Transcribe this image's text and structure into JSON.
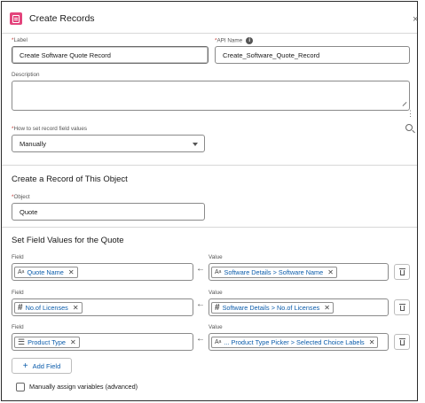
{
  "header": {
    "title": "Create Records",
    "close_icon": "close-icon"
  },
  "label_field": {
    "label": "Label",
    "value": "Create Software Quote Record"
  },
  "api_name_field": {
    "label": "API Name",
    "value": "Create_Software_Quote_Record"
  },
  "description_field": {
    "label": "Description",
    "value": ""
  },
  "how_to_set": {
    "label": "How to set record field values",
    "value": "Manually"
  },
  "create_section": {
    "title": "Create a Record of This Object"
  },
  "object_field": {
    "label": "Object",
    "value": "Quote"
  },
  "set_values_section": {
    "title": "Set Field Values for the Quote"
  },
  "field_rows": [
    {
      "field_label": "Field",
      "field_icon": "text-icon",
      "field_value": "Quote Name",
      "value_label": "Value",
      "value_icon": "text-icon",
      "value_text": "Software Details > Software Name"
    },
    {
      "field_label": "Field",
      "field_icon": "number-icon",
      "field_value": "No.of Licenses",
      "value_label": "Value",
      "value_icon": "number-icon",
      "value_text": "Software Details > No.of Licenses"
    },
    {
      "field_label": "Field",
      "field_icon": "picklist-icon",
      "field_value": "Product Type",
      "value_label": "Value",
      "value_icon": "text-icon",
      "value_text": "... Product Type Picker > Selected Choice Labels"
    }
  ],
  "add_field_button": {
    "label": "Add Field"
  },
  "manual_assign": {
    "label": "Manually assign variables (advanced)",
    "checked": false
  },
  "colors": {
    "accent": "#0b5cab",
    "header_icon": "#e3447c",
    "required": "#c23934"
  }
}
